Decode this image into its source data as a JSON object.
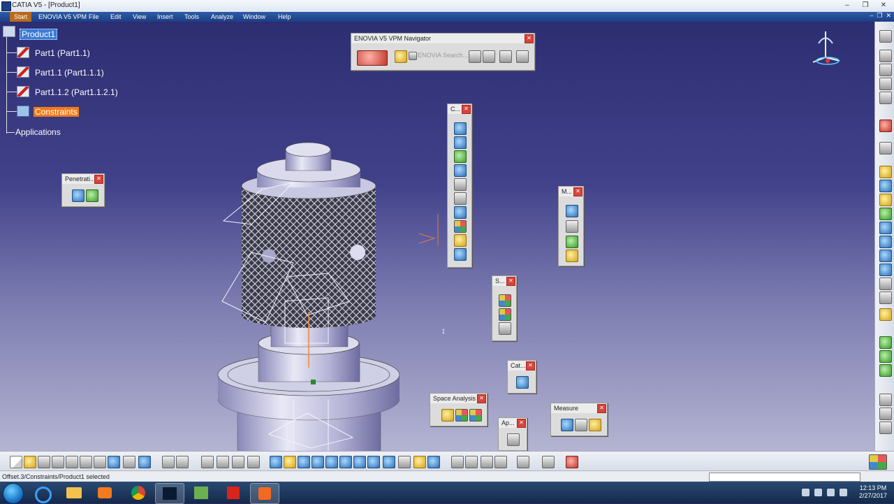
{
  "window": {
    "title": "CATIA V5 - [Product1]",
    "controls": [
      "–",
      "❐",
      "✕"
    ]
  },
  "menu": {
    "items": [
      "Start",
      "ENOVIA V5 VPM",
      "File",
      "Edit",
      "View",
      "Insert",
      "Tools",
      "Analyze",
      "Window",
      "Help"
    ],
    "mdi_controls": [
      "–",
      "❐",
      "✕"
    ]
  },
  "tree": {
    "root": "Product1",
    "children": [
      "Part1 (Part1.1)",
      "Part1.1 (Part1.1.1)",
      "Part1.1.2 (Part1.1.2.1)",
      "Constraints"
    ],
    "applications": "Applications"
  },
  "toolbars": {
    "enovia": {
      "title": "ENOVIA V5 VPM Navigator",
      "search_placeholder": "ENOVIA Search..."
    },
    "penetration": {
      "title": "Penetrati..."
    },
    "constraints": {
      "title": "C..."
    },
    "m": {
      "title": "M..."
    },
    "s": {
      "title": "S..."
    },
    "cat": {
      "title": "Cat..."
    },
    "space_analysis": {
      "title": "Space Analysis"
    },
    "ap": {
      "title": "Ap..."
    },
    "measure": {
      "title": "Measure"
    }
  },
  "status": {
    "text": "Offset.3/Constraints/Product1 selected"
  },
  "taskbar": {
    "time": "12:13 PM",
    "date": "2/27/2017"
  },
  "colors": {
    "background_top": "#2d2d72",
    "background_bottom": "#b4b4d2",
    "selection": "#3a7bd5",
    "constraint_highlight": "#f07a1a",
    "menubar": "#1b3f86"
  }
}
